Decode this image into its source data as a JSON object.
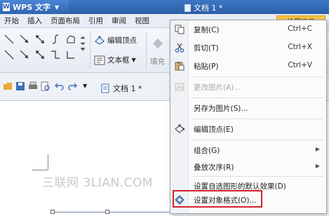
{
  "app": {
    "wps_button": "WPS 文字",
    "document_title": "文档 1 *"
  },
  "menubar": {
    "items": [
      "开始",
      "插入",
      "页面布局",
      "引用",
      "审阅",
      "视图"
    ],
    "drawing_tools": "绘图工具"
  },
  "ribbon": {
    "edit_vertices": "编辑顶点",
    "text_box": "文本框",
    "fill": "填充"
  },
  "quickbar": {
    "doc_tab": "文档 1 *"
  },
  "watermark": "三联网 3LIAN.COM",
  "context_menu": {
    "items": [
      {
        "icon": "copy-icon",
        "label": "复制(C)",
        "shortcut": "Ctrl+C",
        "enabled": true
      },
      {
        "icon": "cut-icon",
        "label": "剪切(T)",
        "shortcut": "Ctrl+X",
        "enabled": true
      },
      {
        "icon": "paste-icon",
        "label": "粘贴(P)",
        "shortcut": "Ctrl+V",
        "enabled": true
      },
      {
        "icon": "change-picture-icon",
        "label": "更改图片(A)...",
        "shortcut": "",
        "enabled": false
      },
      {
        "icon": "",
        "label": "另存为图片(S)...",
        "shortcut": "",
        "enabled": true
      },
      {
        "icon": "edit-vertices-icon",
        "label": "编辑顶点(E)",
        "shortcut": "",
        "enabled": true
      },
      {
        "icon": "",
        "label": "组合(G)",
        "shortcut": "",
        "enabled": true,
        "submenu": true
      },
      {
        "icon": "",
        "label": "叠放次序(R)",
        "shortcut": "",
        "enabled": true,
        "submenu": true
      },
      {
        "icon": "",
        "label": "设置自选图形的默认效果(D)",
        "shortcut": "",
        "enabled": true
      },
      {
        "icon": "format-object-icon",
        "label": "设置对象格式(O)...",
        "shortcut": "",
        "enabled": true
      }
    ]
  },
  "colors": {
    "title_bar": "#2c5ea8",
    "highlight_box": "#d2232a",
    "drawing_tools_tab": "#f7c046"
  }
}
